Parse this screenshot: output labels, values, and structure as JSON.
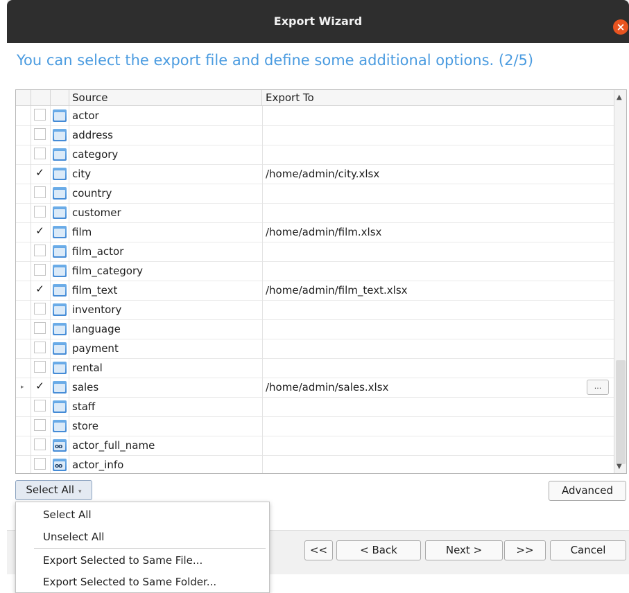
{
  "window": {
    "title": "Export Wizard",
    "close_glyph": "×"
  },
  "page": {
    "headline": "You can select the export file and define some additional options. (2/5)"
  },
  "grid": {
    "columns": [
      "Source",
      "Export To"
    ],
    "rows": [
      {
        "source": "actor",
        "export_to": "",
        "checked": false,
        "check_glyph": "",
        "icon": "table-icon"
      },
      {
        "source": "address",
        "export_to": "",
        "checked": false,
        "check_glyph": "",
        "icon": "table-icon"
      },
      {
        "source": "category",
        "export_to": "",
        "checked": false,
        "check_glyph": "",
        "icon": "table-icon"
      },
      {
        "source": "city",
        "export_to": "/home/admin/city.xlsx",
        "checked": true,
        "check_glyph": "✓",
        "icon": "table-icon"
      },
      {
        "source": "country",
        "export_to": "",
        "checked": false,
        "check_glyph": "",
        "icon": "table-icon"
      },
      {
        "source": "customer",
        "export_to": "",
        "checked": false,
        "check_glyph": "",
        "icon": "table-icon"
      },
      {
        "source": "film",
        "export_to": "/home/admin/film.xlsx",
        "checked": true,
        "check_glyph": "✓",
        "icon": "table-icon"
      },
      {
        "source": "film_actor",
        "export_to": "",
        "checked": false,
        "check_glyph": "",
        "icon": "table-icon"
      },
      {
        "source": "film_category",
        "export_to": "",
        "checked": false,
        "check_glyph": "",
        "icon": "table-icon"
      },
      {
        "source": "film_text",
        "export_to": "/home/admin/film_text.xlsx",
        "checked": true,
        "check_glyph": "✓",
        "icon": "table-icon"
      },
      {
        "source": "inventory",
        "export_to": "",
        "checked": false,
        "check_glyph": "",
        "icon": "table-icon"
      },
      {
        "source": "language",
        "export_to": "",
        "checked": false,
        "check_glyph": "",
        "icon": "table-icon"
      },
      {
        "source": "payment",
        "export_to": "",
        "checked": false,
        "check_glyph": "",
        "icon": "table-icon"
      },
      {
        "source": "rental",
        "export_to": "",
        "checked": false,
        "check_glyph": "",
        "icon": "table-icon"
      },
      {
        "source": "sales",
        "export_to": "/home/admin/sales.xlsx",
        "checked": true,
        "check_glyph": "✓",
        "icon": "table-icon",
        "current": true,
        "current_glyph": "▸",
        "browse_label": "..."
      },
      {
        "source": "staff",
        "export_to": "",
        "checked": false,
        "check_glyph": "",
        "icon": "table-icon"
      },
      {
        "source": "store",
        "export_to": "",
        "checked": false,
        "check_glyph": "",
        "icon": "table-icon"
      },
      {
        "source": "actor_full_name",
        "export_to": "",
        "checked": false,
        "check_glyph": "",
        "icon": "view-icon",
        "view_glyph": "oo"
      },
      {
        "source": "actor_info",
        "export_to": "",
        "checked": false,
        "check_glyph": "",
        "icon": "view-icon",
        "view_glyph": "oo"
      }
    ],
    "scroll_up_glyph": "▲",
    "scroll_down_glyph": "▼"
  },
  "buttons": {
    "select_all": "Select All",
    "select_all_caret": "▾",
    "advanced": "Advanced",
    "first": "<<",
    "back": "< Back",
    "next": "Next >",
    "last": ">>",
    "cancel": "Cancel"
  },
  "menu": {
    "items": [
      "Select All",
      "Unselect All",
      "Export Selected to Same File...",
      "Export Selected to Same Folder..."
    ]
  }
}
